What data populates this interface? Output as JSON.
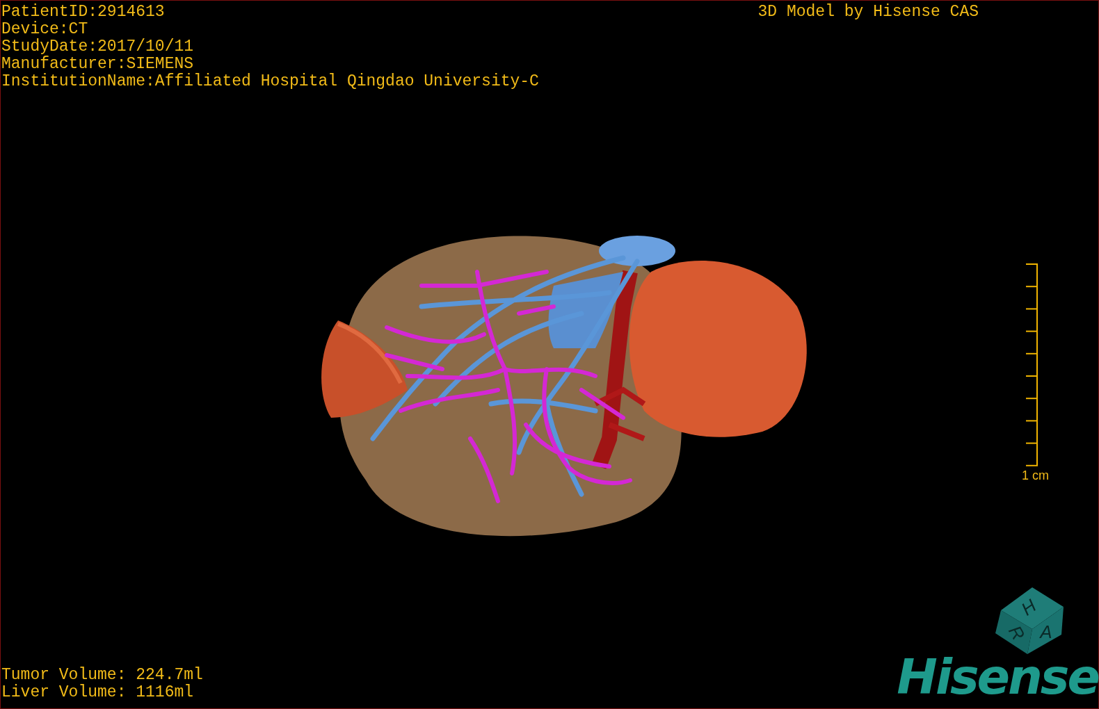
{
  "info_lines": [
    "PatientID:2914613",
    "Device:CT",
    "StudyDate:2017/10/11",
    "Manufacturer:SIEMENS",
    "InstitutionName:Affiliated Hospital Qingdao University-C"
  ],
  "title": "3D Model by Hisense CAS",
  "scale_bar": {
    "label": "1 cm"
  },
  "orientation_cube": {
    "faces": [
      {
        "letter": "H"
      },
      {
        "letter": "R"
      },
      {
        "letter": "A"
      }
    ]
  },
  "logo": "Hisense",
  "volumes": [
    "Tumor Volume: 224.7ml",
    "Liver Volume: 1116ml"
  ]
}
